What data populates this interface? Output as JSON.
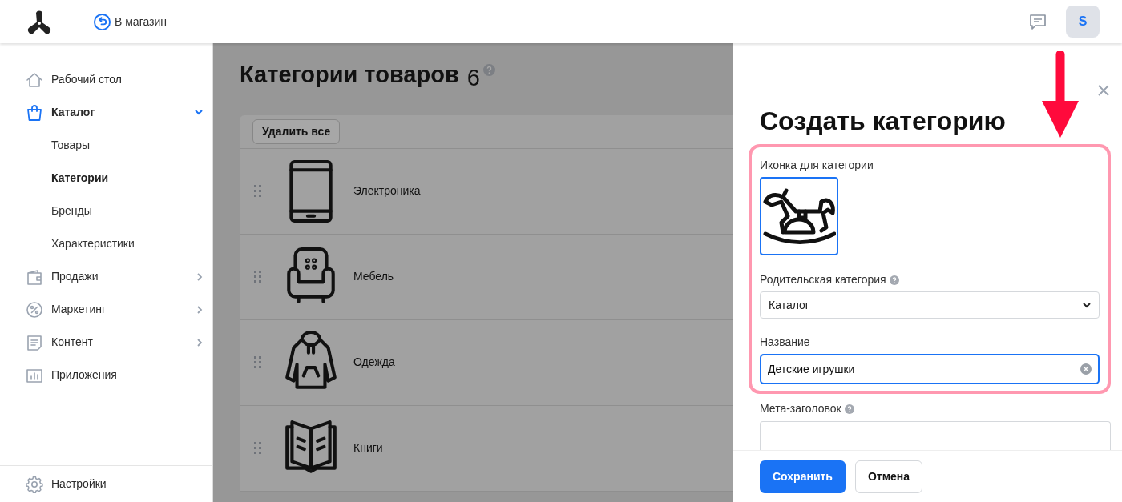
{
  "header": {
    "back_link": "В магазин",
    "avatar": "S"
  },
  "sidebar": {
    "items": [
      {
        "label": "Рабочий стол",
        "selected": false
      },
      {
        "label": "Каталог",
        "selected": true,
        "expanded": true,
        "children": [
          {
            "label": "Товары",
            "selected": false
          },
          {
            "label": "Категории",
            "selected": true
          },
          {
            "label": "Бренды",
            "selected": false
          },
          {
            "label": "Характеристики",
            "selected": false
          }
        ]
      },
      {
        "label": "Продажи",
        "selected": false,
        "expanded": false
      },
      {
        "label": "Маркетинг",
        "selected": false,
        "expanded": false
      },
      {
        "label": "Контент",
        "selected": false,
        "expanded": false
      },
      {
        "label": "Приложения",
        "selected": false
      }
    ],
    "settings": "Настройки"
  },
  "page": {
    "title": "Категории товаров",
    "count": "6",
    "delete_all": "Удалить все",
    "categories": [
      {
        "name": "Электроника"
      },
      {
        "name": "Мебель"
      },
      {
        "name": "Одежда"
      },
      {
        "name": "Книги"
      }
    ]
  },
  "panel": {
    "title": "Создать категорию",
    "icon_label": "Иконка для категории",
    "parent_label": "Родительская категория",
    "parent_value": "Каталог",
    "name_label": "Название",
    "name_value": "Детские игрушки",
    "meta_label": "Мета-заголовок",
    "save": "Сохранить",
    "cancel": "Отмена"
  }
}
